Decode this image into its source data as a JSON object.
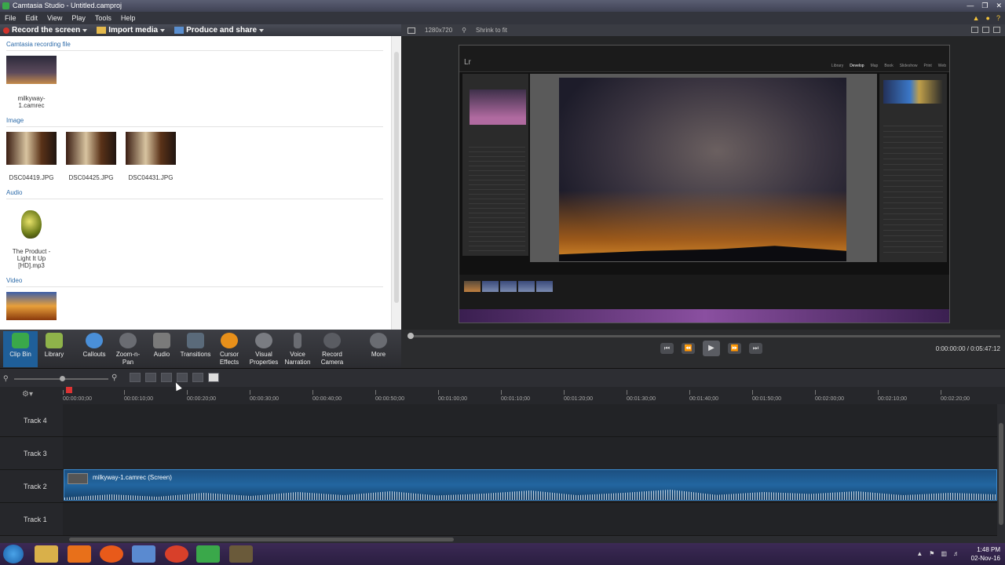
{
  "window": {
    "title": "Camtasia Studio - Untitled.camproj"
  },
  "menu": [
    "File",
    "Edit",
    "View",
    "Play",
    "Tools",
    "Help"
  ],
  "toolbar": {
    "record": "Record the screen",
    "import": "Import media",
    "produce": "Produce and share"
  },
  "clip_bin": {
    "sections": [
      {
        "title": "Camtasia recording file",
        "items": [
          {
            "name": "milkyway-1.camrec"
          }
        ]
      },
      {
        "title": "Image",
        "items": [
          {
            "name": "DSC04419.JPG"
          },
          {
            "name": "DSC04425.JPG"
          },
          {
            "name": "DSC04431.JPG"
          }
        ]
      },
      {
        "title": "Audio",
        "items": [
          {
            "name": "The Product - Light It Up [HD].mp3"
          }
        ]
      },
      {
        "title": "Video",
        "items": [
          {
            "name": ""
          }
        ]
      }
    ]
  },
  "preview": {
    "resolution": "1280x720",
    "zoom": "Shrink to fit"
  },
  "lightroom": {
    "logo": "Lr",
    "modules": [
      "Library",
      "Develop",
      "Map",
      "Book",
      "Slideshow",
      "Print",
      "Web"
    ],
    "active_module": "Develop"
  },
  "playback": {
    "timecode": "0:00:00:00 / 0:05:47:12",
    "buttons": [
      "prev-clip",
      "rewind",
      "play",
      "fast-forward",
      "next-clip"
    ]
  },
  "tasks": [
    {
      "label": "Clip Bin",
      "icon": "clip-bin-icon",
      "color": "#3aa84a",
      "selected": true
    },
    {
      "label": "Library",
      "icon": "library-icon",
      "color": "#8fb34a"
    },
    {
      "label": "Callouts",
      "icon": "callouts-icon",
      "color": "#4a8fd8"
    },
    {
      "label": "Zoom-n-Pan",
      "icon": "zoom-icon",
      "color": "#6a6c72"
    },
    {
      "label": "Audio",
      "icon": "audio-icon",
      "color": "#7a7a7a"
    },
    {
      "label": "Transitions",
      "icon": "transitions-icon",
      "color": "#5a6a7a"
    },
    {
      "label": "Cursor Effects",
      "icon": "cursor-effects-icon",
      "color": "#e8901a"
    },
    {
      "label": "Visual Properties",
      "icon": "visual-properties-icon",
      "color": "#7a7c82"
    },
    {
      "label": "Voice Narration",
      "icon": "microphone-icon",
      "color": "#6a6c72"
    },
    {
      "label": "Record Camera",
      "icon": "camera-icon",
      "color": "#5a5c62"
    },
    {
      "label": "More",
      "icon": "more-icon",
      "color": "#6a6c72"
    }
  ],
  "timeline": {
    "ruler": [
      "00:00:00;00",
      "00:00:10;00",
      "00:00:20;00",
      "00:00:30;00",
      "00:00:40;00",
      "00:00:50;00",
      "00:01:00;00",
      "00:01:10;00",
      "00:01:20;00",
      "00:01:30;00",
      "00:01:40;00",
      "00:01:50;00",
      "00:02:00;00",
      "00:02:10;00",
      "00:02:20;00"
    ],
    "tracks": [
      "Track 4",
      "Track 3",
      "Track 2",
      "Track 1"
    ],
    "clip_label": "milkyway-1.camrec (Screen)"
  },
  "taskbar": {
    "time": "1:48 PM",
    "date": "02-Nov-16"
  }
}
